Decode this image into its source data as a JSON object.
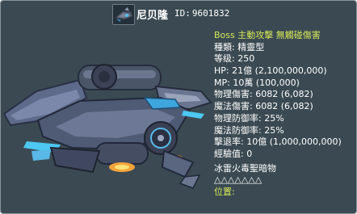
{
  "header": {
    "name": "尼贝隆",
    "id_label": "ID:",
    "id_value": "9601832"
  },
  "stats": {
    "tags": "Boss 主動攻擊 無觸碰傷害",
    "type_label": "種類:",
    "type_value": "精靈型",
    "level_label": "等级:",
    "level_value": "250",
    "hp_label": "HP:",
    "hp_value": "21億 (2,100,000,000)",
    "mp_label": "MP:",
    "mp_value": "10萬 (100,000)",
    "phys_dmg_label": "物理傷害:",
    "phys_dmg_value": "6082 (6,082)",
    "mag_dmg_label": "魔法傷害:",
    "mag_dmg_value": "6082 (6,082)",
    "phys_def_label": "物理防御率:",
    "phys_def_value": "25%",
    "mag_def_label": "魔法防御率:",
    "mag_def_value": "25%",
    "knockback_label": "擊退率:",
    "knockback_value": "10億 (1,000,000,000)",
    "exp_label": "經驗值:",
    "exp_value": "0",
    "elements": "冰雷火毒聖暗物",
    "element_marks": "△△△△△△△",
    "location_label": "位置:"
  }
}
